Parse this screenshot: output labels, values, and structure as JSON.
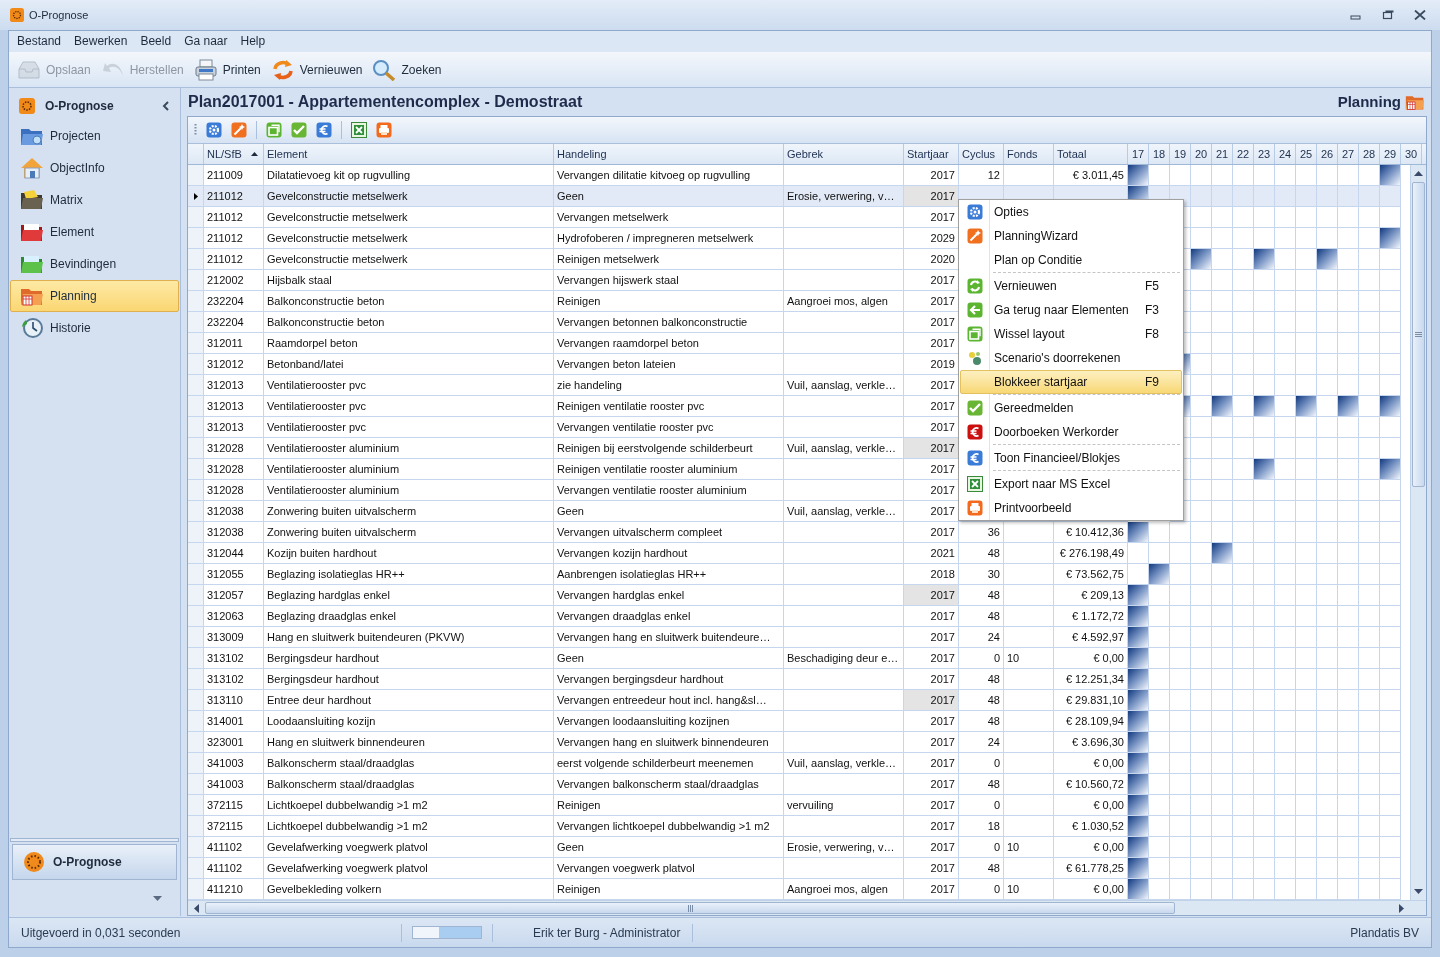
{
  "window": {
    "title": "O-Prognose"
  },
  "menu_bar": [
    "Bestand",
    "Bewerken",
    "Beeld",
    "Ga naar",
    "Help"
  ],
  "toolbar": [
    {
      "label": "Opslaan",
      "disabled": true
    },
    {
      "label": "Herstellen",
      "disabled": true
    },
    {
      "label": "Printen",
      "disabled": false
    },
    {
      "label": "Vernieuwen",
      "disabled": false
    },
    {
      "label": "Zoeken",
      "disabled": false
    }
  ],
  "sidebar": {
    "title": "O-Prognose",
    "items": [
      {
        "label": "Projecten",
        "selected": false
      },
      {
        "label": "ObjectInfo",
        "selected": false
      },
      {
        "label": "Matrix",
        "selected": false
      },
      {
        "label": "Element",
        "selected": false
      },
      {
        "label": "Bevindingen",
        "selected": false
      },
      {
        "label": "Planning",
        "selected": true
      },
      {
        "label": "Historie",
        "selected": false
      }
    ],
    "footer_button": "O-Prognose"
  },
  "page": {
    "title": "Plan2017001 - Appartementencomplex - Demostraat",
    "section": "Planning"
  },
  "table": {
    "columns": [
      {
        "label": "NL/SfB",
        "sorted": true
      },
      {
        "label": "Element",
        "sorted": false
      },
      {
        "label": "Handeling",
        "sorted": false
      },
      {
        "label": "Gebrek",
        "sorted": false
      },
      {
        "label": "Startjaar",
        "sorted": false
      },
      {
        "label": "Cyclus",
        "sorted": false
      },
      {
        "label": "Fonds",
        "sorted": false
      },
      {
        "label": "Totaal",
        "sorted": false
      }
    ],
    "years": [
      "17",
      "18",
      "19",
      "20",
      "21",
      "22",
      "23",
      "24",
      "25",
      "26",
      "27",
      "28",
      "29",
      "30"
    ],
    "rows": [
      {
        "nlsfb": "211009",
        "element": "Dilatatievoeg kit op rugvulling",
        "handeling": "Vervangen dilitatie kitvoeg op rugvulling",
        "startjaar": "2017",
        "startjaar_locked": false,
        "cyclus": "12",
        "totaal": "€ 3.011,45",
        "selected": false,
        "planned": [
          true,
          false,
          false,
          false,
          false,
          false,
          false,
          false,
          false,
          false,
          false,
          false,
          true
        ]
      },
      {
        "nlsfb": "211012",
        "element": "Gevelconstructie metselwerk",
        "handeling": "Geen",
        "gebrek": "Erosie, verwering, v…",
        "startjaar": "2017",
        "startjaar_locked": true,
        "selected": true,
        "planned": [
          true,
          false,
          false,
          false,
          false,
          false,
          false,
          false,
          false,
          false,
          false,
          false,
          false
        ]
      },
      {
        "nlsfb": "211012",
        "element": "Gevelconstructie metselwerk",
        "handeling": "Vervangen metselwerk",
        "startjaar": "2017",
        "startjaar_locked": false,
        "selected": false,
        "planned": [
          false,
          false,
          false,
          false,
          false,
          false,
          false,
          false,
          false,
          false,
          false
        ]
      },
      {
        "nlsfb": "211012",
        "element": "Gevelconstructie metselwerk",
        "handeling": "Hydrofoberen / impregneren metselwerk",
        "startjaar": "2029",
        "startjaar_locked": false,
        "selected": false,
        "planned": [
          false,
          false,
          false,
          false,
          false,
          false,
          false,
          false,
          false,
          false,
          true
        ]
      },
      {
        "nlsfb": "211012",
        "element": "Gevelconstructie metselwerk",
        "handeling": "Reinigen metselwerk",
        "startjaar": "2020",
        "startjaar_locked": false,
        "selected": false,
        "planned": [
          false,
          true,
          false,
          false,
          true,
          false,
          false,
          true,
          false,
          false,
          false
        ]
      },
      {
        "nlsfb": "212002",
        "element": "Hijsbalk staal",
        "handeling": "Vervangen hijswerk staal",
        "startjaar": "2017",
        "startjaar_locked": false,
        "selected": false,
        "planned": [
          false,
          false,
          false,
          false,
          false,
          false,
          false,
          false,
          false,
          false,
          false
        ]
      },
      {
        "nlsfb": "232204",
        "element": "Balkonconstructie beton",
        "handeling": "Reinigen",
        "gebrek": "Aangroei mos, algen",
        "startjaar": "2017",
        "startjaar_locked": false,
        "selected": false,
        "planned": [
          false,
          false,
          false,
          false,
          false,
          false,
          false,
          false,
          false,
          false,
          false
        ]
      },
      {
        "nlsfb": "232204",
        "element": "Balkonconstructie beton",
        "handeling": "Vervangen betonnen balkonconstructie",
        "startjaar": "2017",
        "startjaar_locked": false,
        "selected": false,
        "planned": [
          false,
          false,
          false,
          false,
          false,
          false,
          false,
          false,
          false,
          false,
          false
        ]
      },
      {
        "nlsfb": "312011",
        "element": "Raamdorpel beton",
        "handeling": "Vervangen raamdorpel beton",
        "startjaar": "2017",
        "startjaar_locked": false,
        "selected": false,
        "planned": [
          false,
          false,
          false,
          false,
          false,
          false,
          false,
          false,
          false,
          false,
          false
        ]
      },
      {
        "nlsfb": "312012",
        "element": "Betonband/latei",
        "handeling": "Vervangen beton lateien",
        "startjaar": "2019",
        "startjaar_locked": false,
        "selected": false,
        "planned": [
          true,
          false,
          false,
          false,
          false,
          false,
          false,
          false,
          false,
          false,
          false
        ]
      },
      {
        "nlsfb": "312013",
        "element": "Ventilatierooster pvc",
        "handeling": "zie handeling",
        "gebrek": "Vuil, aanslag, verkle…",
        "startjaar": "2017",
        "startjaar_locked": false,
        "selected": false,
        "planned": [
          false,
          false,
          false,
          false,
          false,
          false,
          false,
          false,
          false,
          false,
          false
        ]
      },
      {
        "nlsfb": "312013",
        "element": "Ventilatierooster pvc",
        "handeling": "Reinigen ventilatie rooster pvc",
        "startjaar": "2017",
        "startjaar_locked": false,
        "selected": false,
        "planned": [
          true,
          false,
          true,
          false,
          true,
          false,
          true,
          false,
          true,
          false,
          true
        ]
      },
      {
        "nlsfb": "312013",
        "element": "Ventilatierooster pvc",
        "handeling": "Vervangen ventilatie rooster pvc",
        "startjaar": "2017",
        "startjaar_locked": false,
        "selected": false,
        "planned": [
          false,
          false,
          false,
          false,
          false,
          false,
          false,
          false,
          false,
          false,
          false
        ]
      },
      {
        "nlsfb": "312028",
        "element": "Ventilatierooster aluminium",
        "handeling": "Reinigen bij eerstvolgende schilderbeurt",
        "gebrek": "Vuil, aanslag, verkle…",
        "startjaar": "2017",
        "startjaar_locked": true,
        "selected": false,
        "planned": [
          false,
          false,
          false,
          false,
          false,
          false,
          false,
          false,
          false,
          false,
          false
        ]
      },
      {
        "nlsfb": "312028",
        "element": "Ventilatierooster aluminium",
        "handeling": "Reinigen ventilatie rooster aluminium",
        "startjaar": "2017",
        "startjaar_locked": false,
        "selected": false,
        "planned": [
          false,
          false,
          false,
          false,
          true,
          false,
          false,
          false,
          false,
          false,
          true
        ]
      },
      {
        "nlsfb": "312028",
        "element": "Ventilatierooster aluminium",
        "handeling": "Vervangen ventilatie rooster aluminium",
        "startjaar": "2017",
        "startjaar_locked": false,
        "selected": false,
        "planned": [
          false,
          false,
          false,
          false,
          false,
          false,
          false,
          false,
          false,
          false,
          false
        ]
      },
      {
        "nlsfb": "312038",
        "element": "Zonwering buiten uitvalscherm",
        "handeling": "Geen",
        "gebrek": "Vuil, aanslag, verkle…",
        "startjaar": "2017",
        "startjaar_locked": false,
        "selected": false,
        "planned": [
          false,
          false,
          false,
          false,
          false,
          false,
          false,
          false,
          false,
          false,
          false
        ]
      },
      {
        "nlsfb": "312038",
        "element": "Zonwering buiten uitvalscherm",
        "handeling": "Vervangen uitvalscherm compleet",
        "startjaar": "2017",
        "startjaar_locked": false,
        "cyclus": "36",
        "totaal": "€ 10.412,36",
        "selected": false,
        "planned": [
          true,
          false,
          false,
          false,
          false,
          false,
          false,
          false,
          false,
          false,
          false,
          false,
          false
        ]
      },
      {
        "nlsfb": "312044",
        "element": "Kozijn buiten hardhout",
        "handeling": "Vervangen kozijn hardhout",
        "startjaar": "2021",
        "startjaar_locked": false,
        "cyclus": "48",
        "totaal": "€ 276.198,49",
        "selected": false,
        "planned": [
          false,
          false,
          false,
          false,
          true,
          false,
          false,
          false,
          false,
          false,
          false,
          false,
          false
        ]
      },
      {
        "nlsfb": "312055",
        "element": "Beglazing isolatieglas HR++",
        "handeling": "Aanbrengen isolatieglas HR++",
        "startjaar": "2018",
        "startjaar_locked": false,
        "cyclus": "30",
        "totaal": "€ 73.562,75",
        "selected": false,
        "planned": [
          false,
          true,
          false,
          false,
          false,
          false,
          false,
          false,
          false,
          false,
          false,
          false,
          false
        ]
      },
      {
        "nlsfb": "312057",
        "element": "Beglazing hardglas enkel",
        "handeling": "Vervangen hardglas enkel",
        "startjaar": "2017",
        "startjaar_locked": true,
        "cyclus": "48",
        "totaal": "€ 209,13",
        "selected": false,
        "planned": [
          true,
          false,
          false,
          false,
          false,
          false,
          false,
          false,
          false,
          false,
          false,
          false,
          false
        ]
      },
      {
        "nlsfb": "312063",
        "element": "Beglazing draadglas enkel",
        "handeling": "Vervangen draadglas enkel",
        "startjaar": "2017",
        "startjaar_locked": false,
        "cyclus": "48",
        "totaal": "€ 1.172,72",
        "selected": false,
        "planned": [
          true,
          false,
          false,
          false,
          false,
          false,
          false,
          false,
          false,
          false,
          false,
          false,
          false
        ]
      },
      {
        "nlsfb": "313009",
        "element": "Hang en sluitwerk buitendeuren (PKVW)",
        "handeling": "Vervangen hang en sluitwerk buitendeure…",
        "startjaar": "2017",
        "startjaar_locked": false,
        "cyclus": "24",
        "totaal": "€ 4.592,97",
        "selected": false,
        "planned": [
          true,
          false,
          false,
          false,
          false,
          false,
          false,
          false,
          false,
          false,
          false,
          false,
          false
        ]
      },
      {
        "nlsfb": "313102",
        "element": "Bergingsdeur hardhout",
        "handeling": "Geen",
        "gebrek": "Beschadiging deur e…",
        "startjaar": "2017",
        "startjaar_locked": false,
        "cyclus": "0",
        "fonds": "10",
        "totaal": "€ 0,00",
        "selected": false,
        "planned": [
          true,
          false,
          false,
          false,
          false,
          false,
          false,
          false,
          false,
          false,
          false,
          false,
          false
        ]
      },
      {
        "nlsfb": "313102",
        "element": "Bergingsdeur hardhout",
        "handeling": "Vervangen bergingsdeur hardhout",
        "startjaar": "2017",
        "startjaar_locked": false,
        "cyclus": "48",
        "totaal": "€ 12.251,34",
        "selected": false,
        "planned": [
          true,
          false,
          false,
          false,
          false,
          false,
          false,
          false,
          false,
          false,
          false,
          false,
          false
        ]
      },
      {
        "nlsfb": "313110",
        "element": "Entree deur hardhout",
        "handeling": "Vervangen entreedeur hout incl. hang&sl…",
        "startjaar": "2017",
        "startjaar_locked": true,
        "cyclus": "48",
        "totaal": "€ 29.831,10",
        "selected": false,
        "planned": [
          true,
          false,
          false,
          false,
          false,
          false,
          false,
          false,
          false,
          false,
          false,
          false,
          false
        ]
      },
      {
        "nlsfb": "314001",
        "element": "Loodaansluiting kozijn",
        "handeling": "Vervangen loodaansluiting kozijnen",
        "startjaar": "2017",
        "startjaar_locked": false,
        "cyclus": "48",
        "totaal": "€ 28.109,94",
        "selected": false,
        "planned": [
          true,
          false,
          false,
          false,
          false,
          false,
          false,
          false,
          false,
          false,
          false,
          false,
          false
        ]
      },
      {
        "nlsfb": "323001",
        "element": "Hang en sluitwerk binnendeuren",
        "handeling": "Vervangen hang en sluitwerk binnendeuren",
        "startjaar": "2017",
        "startjaar_locked": false,
        "cyclus": "24",
        "totaal": "€ 3.696,30",
        "selected": false,
        "planned": [
          true,
          false,
          false,
          false,
          false,
          false,
          false,
          false,
          false,
          false,
          false,
          false,
          false
        ]
      },
      {
        "nlsfb": "341003",
        "element": "Balkonscherm staal/draadglas",
        "handeling": "eerst volgende schilderbeurt meenemen",
        "gebrek": "Vuil, aanslag, verkle…",
        "startjaar": "2017",
        "startjaar_locked": false,
        "cyclus": "0",
        "totaal": "€ 0,00",
        "selected": false,
        "planned": [
          true,
          false,
          false,
          false,
          false,
          false,
          false,
          false,
          false,
          false,
          false,
          false,
          false
        ]
      },
      {
        "nlsfb": "341003",
        "element": "Balkonscherm staal/draadglas",
        "handeling": "Vervangen balkonscherm staal/draadglas",
        "startjaar": "2017",
        "startjaar_locked": false,
        "cyclus": "48",
        "totaal": "€ 10.560,72",
        "selected": false,
        "planned": [
          true,
          false,
          false,
          false,
          false,
          false,
          false,
          false,
          false,
          false,
          false,
          false,
          false
        ]
      },
      {
        "nlsfb": "372115",
        "element": "Lichtkoepel dubbelwandig >1 m2",
        "handeling": "Reinigen",
        "gebrek": "vervuiling",
        "startjaar": "2017",
        "startjaar_locked": false,
        "cyclus": "0",
        "totaal": "€ 0,00",
        "selected": false,
        "planned": [
          true,
          false,
          false,
          false,
          false,
          false,
          false,
          false,
          false,
          false,
          false,
          false,
          false
        ]
      },
      {
        "nlsfb": "372115",
        "element": "Lichtkoepel dubbelwandig >1 m2",
        "handeling": "Vervangen lichtkoepel dubbelwandig >1 m2",
        "startjaar": "2017",
        "startjaar_locked": false,
        "cyclus": "18",
        "totaal": "€ 1.030,52",
        "selected": false,
        "planned": [
          true,
          false,
          false,
          false,
          false,
          false,
          false,
          false,
          false,
          false,
          false,
          false,
          false
        ]
      },
      {
        "nlsfb": "411102",
        "element": "Gevelafwerking voegwerk platvol",
        "handeling": "Geen",
        "gebrek": "Erosie, verwering, v…",
        "startjaar": "2017",
        "startjaar_locked": false,
        "cyclus": "0",
        "fonds": "10",
        "totaal": "€ 0,00",
        "selected": false,
        "planned": [
          true,
          false,
          false,
          false,
          false,
          false,
          false,
          false,
          false,
          false,
          false,
          false,
          false
        ]
      },
      {
        "nlsfb": "411102",
        "element": "Gevelafwerking voegwerk platvol",
        "handeling": "Vervangen voegwerk platvol",
        "startjaar": "2017",
        "startjaar_locked": false,
        "cyclus": "48",
        "totaal": "€ 61.778,25",
        "selected": false,
        "planned": [
          true,
          false,
          false,
          false,
          false,
          false,
          false,
          false,
          false,
          false,
          false,
          false,
          false
        ]
      },
      {
        "nlsfb": "411210",
        "element": "Gevelbekleding volkern",
        "handeling": "Reinigen",
        "gebrek": "Aangroei mos, algen",
        "startjaar": "2017",
        "startjaar_locked": false,
        "cyclus": "0",
        "fonds": "10",
        "totaal": "€ 0,00",
        "selected": false,
        "planned": [
          true,
          false,
          false,
          false,
          false,
          false,
          false,
          false,
          false,
          false,
          false,
          false,
          false
        ]
      }
    ]
  },
  "context_menu": {
    "items": [
      {
        "kind": "item",
        "label": "Opties",
        "selected": false
      },
      {
        "kind": "item",
        "label": "PlanningWizard",
        "selected": false
      },
      {
        "kind": "item",
        "label": "Plan op Conditie",
        "selected": false
      },
      {
        "kind": "separator"
      },
      {
        "kind": "item",
        "label": "Vernieuwen",
        "shortcut": "F5",
        "selected": false
      },
      {
        "kind": "item",
        "label": "Ga terug naar Elementen",
        "shortcut": "F3",
        "selected": false
      },
      {
        "kind": "item",
        "label": "Wissel layout",
        "shortcut": "F8",
        "selected": false
      },
      {
        "kind": "item",
        "label": "Scenario's doorrekenen",
        "selected": false
      },
      {
        "kind": "item",
        "label": "Blokkeer startjaar",
        "shortcut": "F9",
        "selected": true
      },
      {
        "kind": "separator"
      },
      {
        "kind": "item",
        "label": "Gereedmelden",
        "selected": false
      },
      {
        "kind": "item",
        "label": "Doorboeken Werkorder",
        "selected": false
      },
      {
        "kind": "separator"
      },
      {
        "kind": "item",
        "label": "Toon Financieel/Blokjes",
        "selected": false
      },
      {
        "kind": "separator"
      },
      {
        "kind": "item",
        "label": "Export naar MS Excel",
        "selected": false
      },
      {
        "kind": "item",
        "label": "Printvoorbeeld",
        "selected": false
      }
    ]
  },
  "status_bar": {
    "message": "Uitgevoerd in 0,031 seconden",
    "progress": {
      "level": 0.38
    },
    "user": "Erik ter Burg - Administrator",
    "company": "Plandatis BV"
  }
}
